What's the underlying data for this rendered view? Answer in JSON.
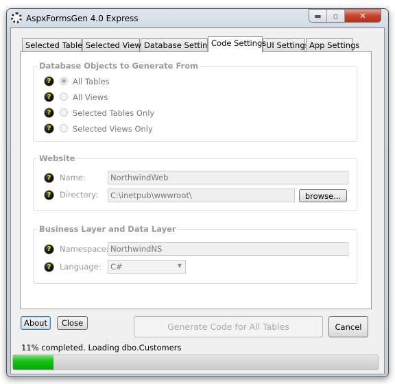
{
  "window": {
    "title": "AspxFormsGen 4.0 Express",
    "min": "▬",
    "max": "▫",
    "close": "✕"
  },
  "tabs": [
    {
      "label": "Selected Tables"
    },
    {
      "label": "Selected Views"
    },
    {
      "label": "Database Settings"
    },
    {
      "label": "Code Settings",
      "active": true
    },
    {
      "label": "UI Settings"
    },
    {
      "label": "App Settings"
    }
  ],
  "db_objects": {
    "title": "Database Objects to Generate From",
    "options": [
      {
        "label": "All Tables",
        "selected": true
      },
      {
        "label": "All Views"
      },
      {
        "label": "Selected Tables Only"
      },
      {
        "label": "Selected Views Only"
      }
    ]
  },
  "website": {
    "title": "Website",
    "name_label": "Name:",
    "name_value": "NorthwindWeb",
    "dir_label": "Directory:",
    "dir_value": "C:\\inetpub\\wwwroot\\",
    "browse": "browse..."
  },
  "layers": {
    "title": "Business Layer and Data Layer",
    "ns_label": "Namespace:",
    "ns_value": "NorthwindNS",
    "lang_label": "Language:",
    "lang_value": "C#"
  },
  "help_glyph": "?",
  "buttons": {
    "about": "About",
    "close": "Close",
    "generate": "Generate Code for All Tables",
    "cancel": "Cancel"
  },
  "status": {
    "text": "11% completed.  Loading dbo.Customers",
    "progress_percent": 11,
    "progress_color": "#14c314"
  }
}
